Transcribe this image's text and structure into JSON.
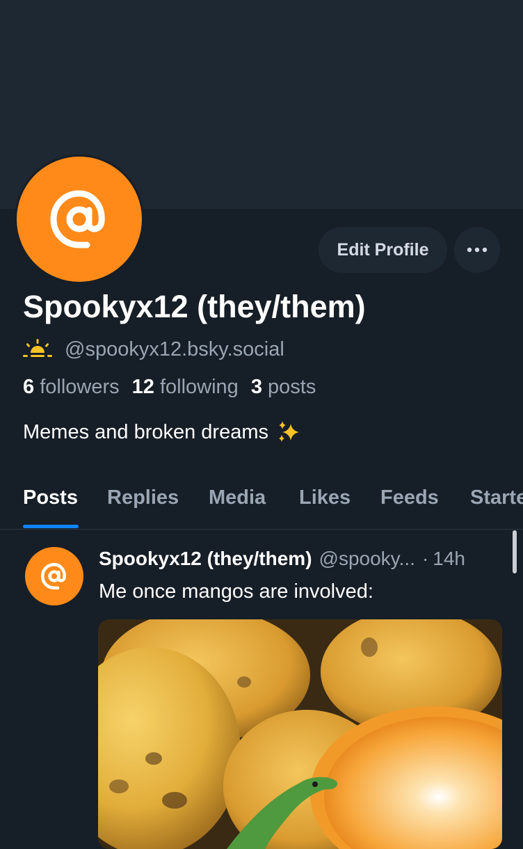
{
  "profile": {
    "display_name": "Spookyx12 (they/them)",
    "handle": "@spookyx12.bsky.social",
    "handle_icon": "sunrise-emoji",
    "bio": "Memes and broken dreams",
    "bio_emoji": "sparkles-emoji",
    "avatar_icon": "at-sign-icon",
    "avatar_color": "#ff8a19",
    "stats": [
      {
        "value": "6",
        "label": "followers"
      },
      {
        "value": "12",
        "label": "following"
      },
      {
        "value": "3",
        "label": "posts"
      }
    ]
  },
  "actions": {
    "edit_profile_label": "Edit Profile",
    "more_icon": "ellipsis-icon"
  },
  "tabs": [
    {
      "label": "Posts",
      "active": true
    },
    {
      "label": "Replies",
      "active": false
    },
    {
      "label": "Media",
      "active": false
    },
    {
      "label": "Likes",
      "active": false
    },
    {
      "label": "Feeds",
      "active": false
    },
    {
      "label": "Starte",
      "active": false
    }
  ],
  "post": {
    "author": "Spookyx12 (they/them)",
    "handle": "@spooky...",
    "separator": "·",
    "time": "14h",
    "text": "Me once mangos are involved:",
    "image_subject": "mangoes with a halved orange and a green lizard"
  },
  "colors": {
    "background": "#161e27",
    "banner": "#1e2833",
    "accent": "#1083fe",
    "muted_text": "#9aa6b3",
    "avatar_orange": "#ff8a19"
  }
}
